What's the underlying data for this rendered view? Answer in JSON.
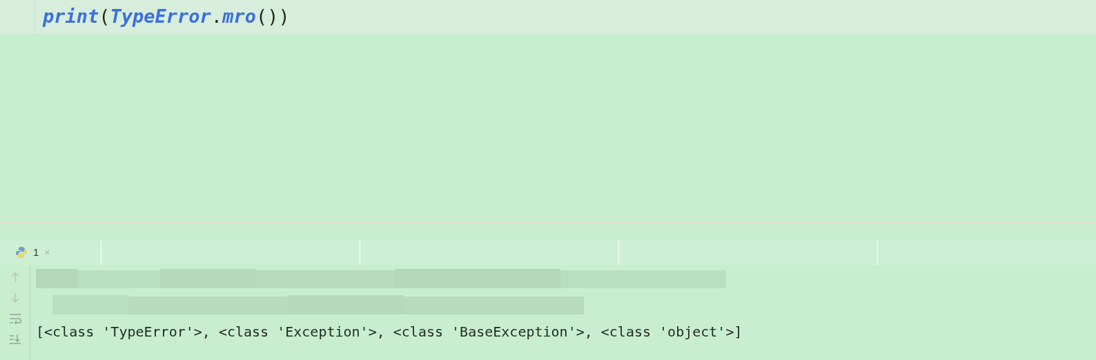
{
  "editor": {
    "code_line": [
      {
        "kind": "name",
        "text": "print"
      },
      {
        "kind": "punct",
        "text": "("
      },
      {
        "kind": "name",
        "text": "TypeError"
      },
      {
        "kind": "punct",
        "text": "."
      },
      {
        "kind": "name",
        "text": "mro"
      },
      {
        "kind": "punct",
        "text": "()"
      },
      {
        "kind": "punct",
        "text": ")"
      }
    ]
  },
  "run_panel": {
    "tabs": [
      {
        "label": "1",
        "close": "×",
        "selected": true
      }
    ],
    "console": [
      {
        "kind": "redacted"
      },
      {
        "kind": "redacted"
      },
      {
        "kind": "text",
        "text": "[<class 'TypeError'>, <class 'Exception'>, <class 'BaseException'>, <class 'object'>]"
      }
    ]
  }
}
